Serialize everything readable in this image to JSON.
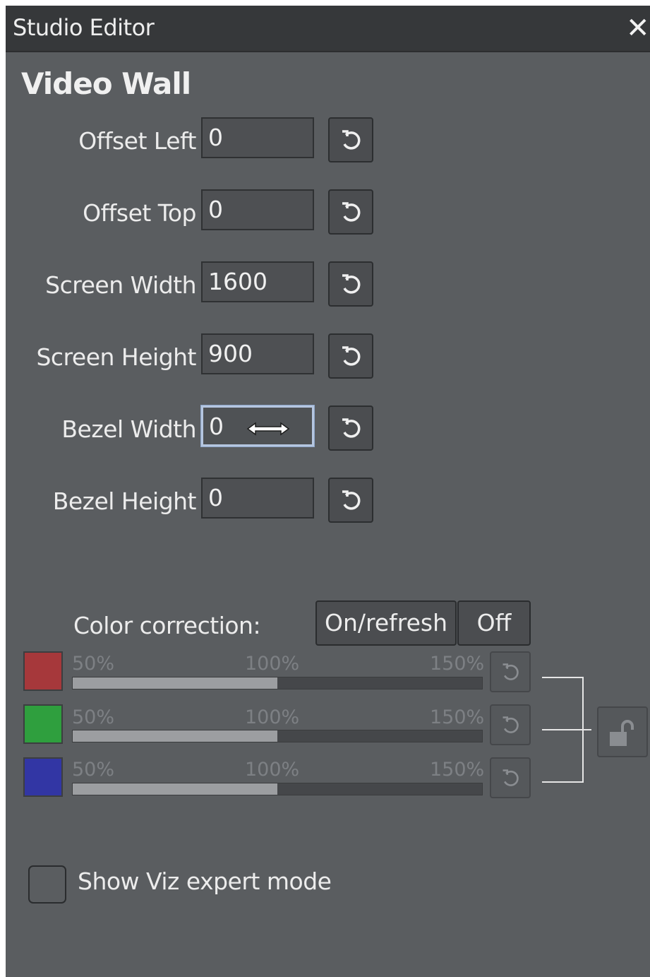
{
  "window": {
    "title": "Studio Editor"
  },
  "section": {
    "title": "Video Wall"
  },
  "fields": [
    {
      "label": "Offset Left",
      "value": "0"
    },
    {
      "label": "Offset Top",
      "value": "0"
    },
    {
      "label": "Screen Width",
      "value": "1600"
    },
    {
      "label": "Screen Height",
      "value": "900"
    },
    {
      "label": "Bezel Width",
      "value": "0"
    },
    {
      "label": "Bezel Height",
      "value": "0"
    }
  ],
  "focused_field": "Bezel Width",
  "color_correction": {
    "label": "Color correction:",
    "on_label": "On/refresh",
    "off_label": "Off",
    "channels": [
      {
        "name": "red",
        "color": "#a6383b",
        "min_label": "50%",
        "mid_label": "100%",
        "max_label": "150%",
        "value_percent": 100
      },
      {
        "name": "green",
        "color": "#2f9f3e",
        "min_label": "50%",
        "mid_label": "100%",
        "max_label": "150%",
        "value_percent": 100
      },
      {
        "name": "blue",
        "color": "#3236a4",
        "min_label": "50%",
        "mid_label": "100%",
        "max_label": "150%",
        "value_percent": 100
      }
    ],
    "lock_state": "unlocked"
  },
  "expert_mode": {
    "label": "Show Viz expert mode",
    "checked": false
  },
  "icons": {
    "close": "close-icon",
    "reset": "reset-icon",
    "lock": "unlock-icon",
    "cursor": "horizontal-resize-cursor-icon"
  }
}
